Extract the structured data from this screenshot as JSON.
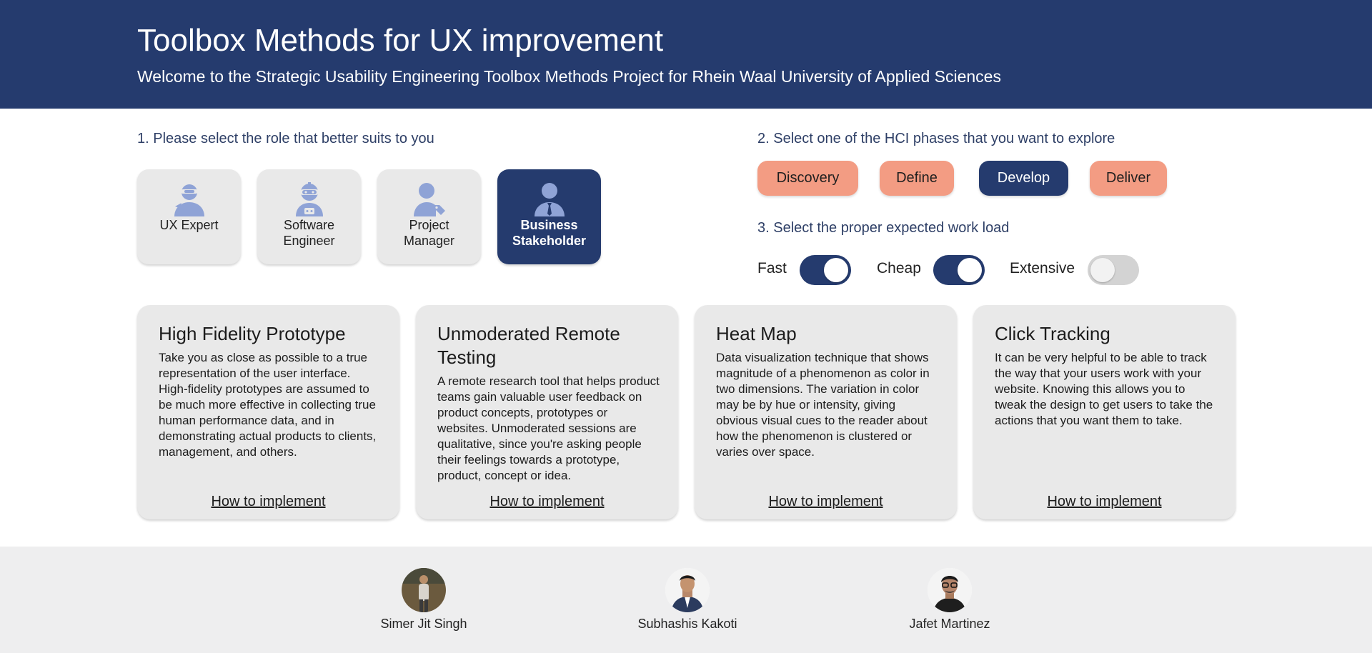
{
  "header": {
    "title": "Toolbox Methods for UX improvement",
    "subtitle": "Welcome to the Strategic Usability Engineering Toolbox Methods Project for Rhein Waal University of Applied Sciences"
  },
  "step1": {
    "label": "1. Please select the role that better suits to you",
    "roles": [
      {
        "line1": "UX Expert",
        "line2": "",
        "icon": "ninja-user-icon",
        "selected": false
      },
      {
        "line1": "Software",
        "line2": "Engineer",
        "icon": "robot-user-icon",
        "selected": false
      },
      {
        "line1": "Project",
        "line2": "Manager",
        "icon": "user-tag-icon",
        "selected": false
      },
      {
        "line1": "Business",
        "line2": "Stakeholder",
        "icon": "user-tie-icon",
        "selected": true
      }
    ]
  },
  "step2": {
    "label": "2. Select one of the HCI phases that you want to explore",
    "phases": [
      {
        "label": "Discovery",
        "selected": false
      },
      {
        "label": "Define",
        "selected": false
      },
      {
        "label": "Develop",
        "selected": true
      },
      {
        "label": "Deliver",
        "selected": false
      }
    ]
  },
  "step3": {
    "label": "3. Select the proper expected work load",
    "toggles": [
      {
        "label": "Fast",
        "on": true
      },
      {
        "label": "Cheap",
        "on": true
      },
      {
        "label": "Extensive",
        "on": false
      }
    ]
  },
  "methods": [
    {
      "title": "High Fidelity Prototype",
      "description": "Take you as close as possible to a true representation of the user interface. High-fidelity prototypes are assumed to be much more effective in collecting true human performance data, and in demonstrating actual products to clients, management, and others.",
      "link": "How to implement"
    },
    {
      "title": "Unmoderated Remote Testing",
      "description": "A remote research tool that helps product teams gain valuable user feedback on product concepts, prototypes or websites. Unmoderated sessions are qualitative, since you're asking people their feelings towards a prototype, product, concept or idea.",
      "link": "How to implement"
    },
    {
      "title": "Heat Map",
      "description": "Data visualization technique that shows magnitude of a phenomenon as color in two dimensions. The variation in color may be by hue or intensity, giving obvious visual cues to the reader about how the phenomenon is clustered or varies over space.",
      "link": "How to implement"
    },
    {
      "title": "Click Tracking",
      "description": "It can be very helpful to be able to track the way that your users work with your website. Knowing this allows you to tweak the design to get users to take the actions that you want them to take.",
      "link": "How to implement"
    }
  ],
  "footer": {
    "people": [
      {
        "name": "Simer Jit Singh"
      },
      {
        "name": "Subhashis Kakoti"
      },
      {
        "name": "Jafet Martinez"
      }
    ]
  },
  "colors": {
    "primary": "#253b6e",
    "accent": "#f39c83",
    "card": "#e9e9e9",
    "footer": "#eeeeef",
    "icon": "#8fa3d6"
  }
}
